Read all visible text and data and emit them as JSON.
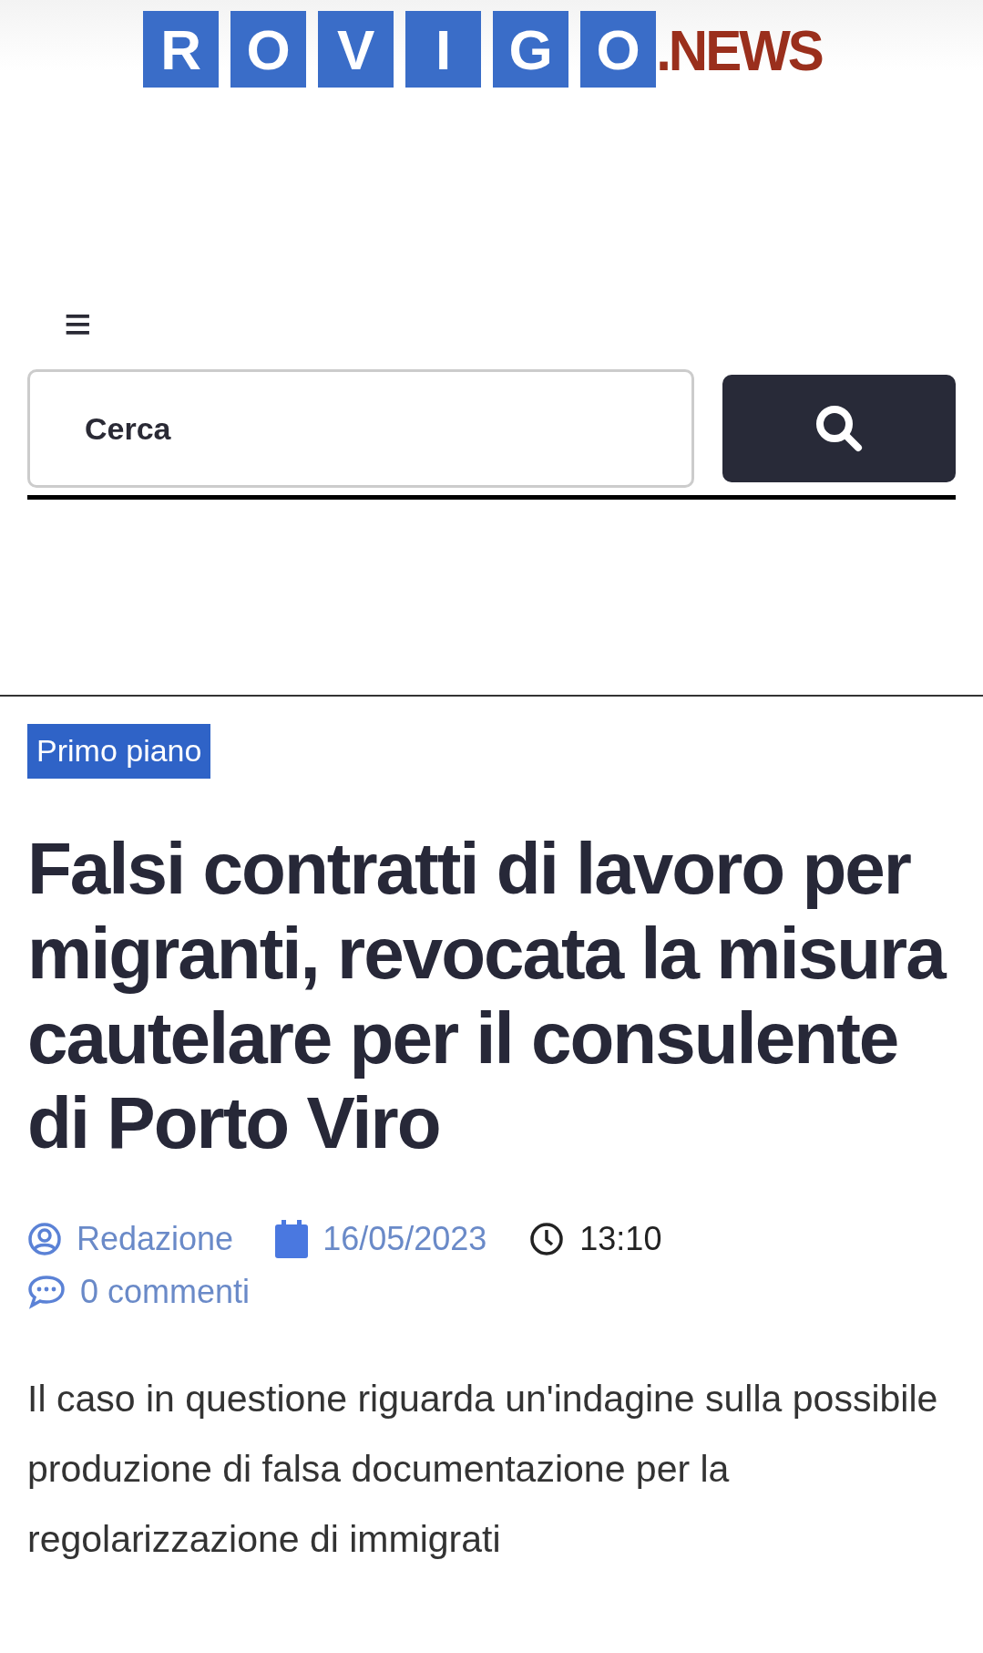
{
  "logo": {
    "letters": [
      "R",
      "O",
      "V",
      "I",
      "G",
      "O"
    ],
    "suffix": ".NEWS"
  },
  "menu": {
    "icon": "≡"
  },
  "search": {
    "placeholder": "Cerca"
  },
  "article": {
    "category": "Primo piano",
    "title": "Falsi contratti di lavoro per migranti, revocata la misura cautelare per il consulente di Porto Viro",
    "meta": [
      {
        "kind": "author",
        "text": "Redazione"
      },
      {
        "kind": "date",
        "text": "16/05/2023"
      },
      {
        "kind": "time",
        "text": "13:10"
      },
      {
        "kind": "comments",
        "text": "0 commenti"
      }
    ],
    "lead": "Il caso in questione riguarda un'indagine sulla possibile produzione di falsa documentazione per la regolarizzazione di immigrati"
  }
}
